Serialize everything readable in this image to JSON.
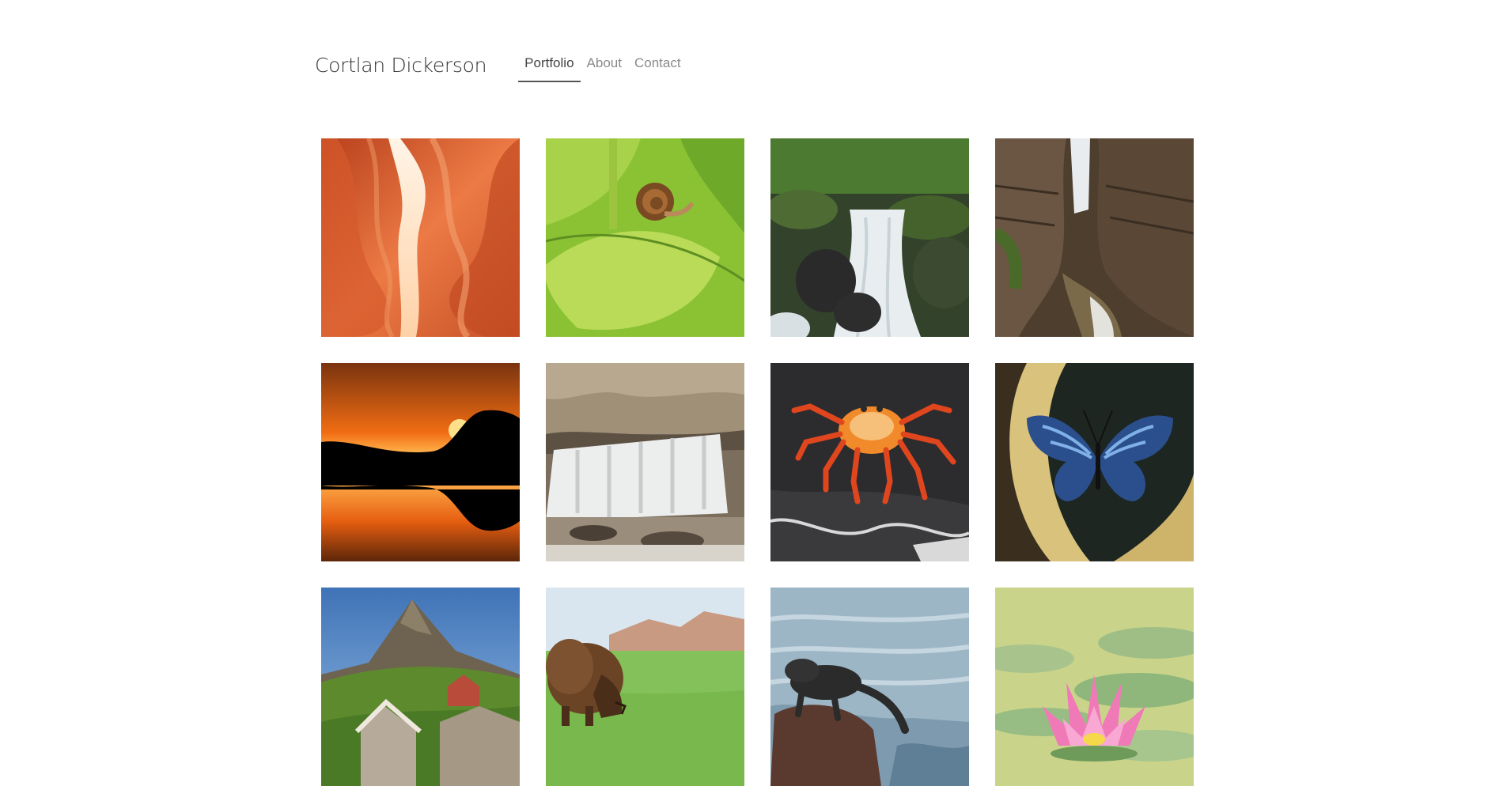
{
  "site": {
    "title": "Cortlan Dickerson"
  },
  "nav": {
    "items": [
      {
        "label": "Portfolio",
        "active": true
      },
      {
        "label": "About",
        "active": false
      },
      {
        "label": "Contact",
        "active": false
      }
    ]
  },
  "gallery": {
    "photos": [
      {
        "subject": "slot canyon",
        "palette": [
          "#e2663a",
          "#f59a6b",
          "#ffe7d2"
        ]
      },
      {
        "subject": "snail on leaf",
        "palette": [
          "#7fb52c",
          "#b8d84a",
          "#8b5a2b"
        ]
      },
      {
        "subject": "mossy waterfall",
        "palette": [
          "#3d5a2a",
          "#e9eef0",
          "#2b2b2b"
        ]
      },
      {
        "subject": "gorge waterfall",
        "palette": [
          "#5a4632",
          "#8c7258",
          "#3f5a2a"
        ]
      },
      {
        "subject": "sunset over lake",
        "palette": [
          "#f06a12",
          "#ffc04a",
          "#000000"
        ]
      },
      {
        "subject": "woodland cascade",
        "palette": [
          "#8d7d68",
          "#f2f2f2",
          "#4d4338"
        ]
      },
      {
        "subject": "red crab on rock",
        "palette": [
          "#2e2e30",
          "#e9552a",
          "#f6c07a"
        ]
      },
      {
        "subject": "blue butterfly",
        "palette": [
          "#1d2520",
          "#d7c07a",
          "#3a6fb6"
        ]
      },
      {
        "subject": "mountain village",
        "palette": [
          "#4a7fbf",
          "#6f9a3a",
          "#b9ad9c"
        ]
      },
      {
        "subject": "grazing bison",
        "palette": [
          "#dbe6ee",
          "#86c25a",
          "#6b4426"
        ]
      },
      {
        "subject": "marine iguana",
        "palette": [
          "#9fb8c8",
          "#2b2b2b",
          "#5a3a2e"
        ]
      },
      {
        "subject": "pink water lily",
        "palette": [
          "#c9d58a",
          "#8fc08a",
          "#f07ab8"
        ]
      }
    ]
  }
}
